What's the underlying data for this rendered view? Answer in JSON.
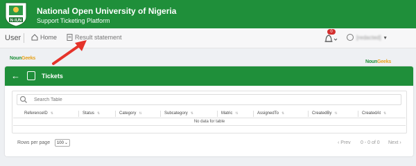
{
  "header": {
    "university_name": "National Open University of Nigeria",
    "subtitle": "Support Ticketing Platform",
    "logo_text": "N◦IUN"
  },
  "nav": {
    "section_label": "User",
    "home_label": "Home",
    "result_label": "Result statement",
    "notification_count": "0",
    "user_name": "[redacted]"
  },
  "brand": {
    "left_part1": "Noun",
    "left_part2": "Geeks",
    "right_part1": "Noun",
    "right_part2": "Geeks"
  },
  "card": {
    "title": "Tickets",
    "search_placeholder": "Search Table",
    "columns": [
      "ReferenceID",
      "Status",
      "Category",
      "Subcategory",
      "Matric",
      "AssignedTo",
      "CreatedBy",
      "CreatedAt"
    ],
    "empty_text": "No data for table",
    "rows_per_page_label": "Rows per page",
    "rows_per_page_value": "100",
    "prev_label": "‹ Prev",
    "range_text": "0 - 0 of 0",
    "next_label": "Next ›"
  },
  "colors": {
    "brand_green": "#1f8f3a",
    "badge_red": "#d32f2f",
    "arrow_red": "#e5332a"
  }
}
